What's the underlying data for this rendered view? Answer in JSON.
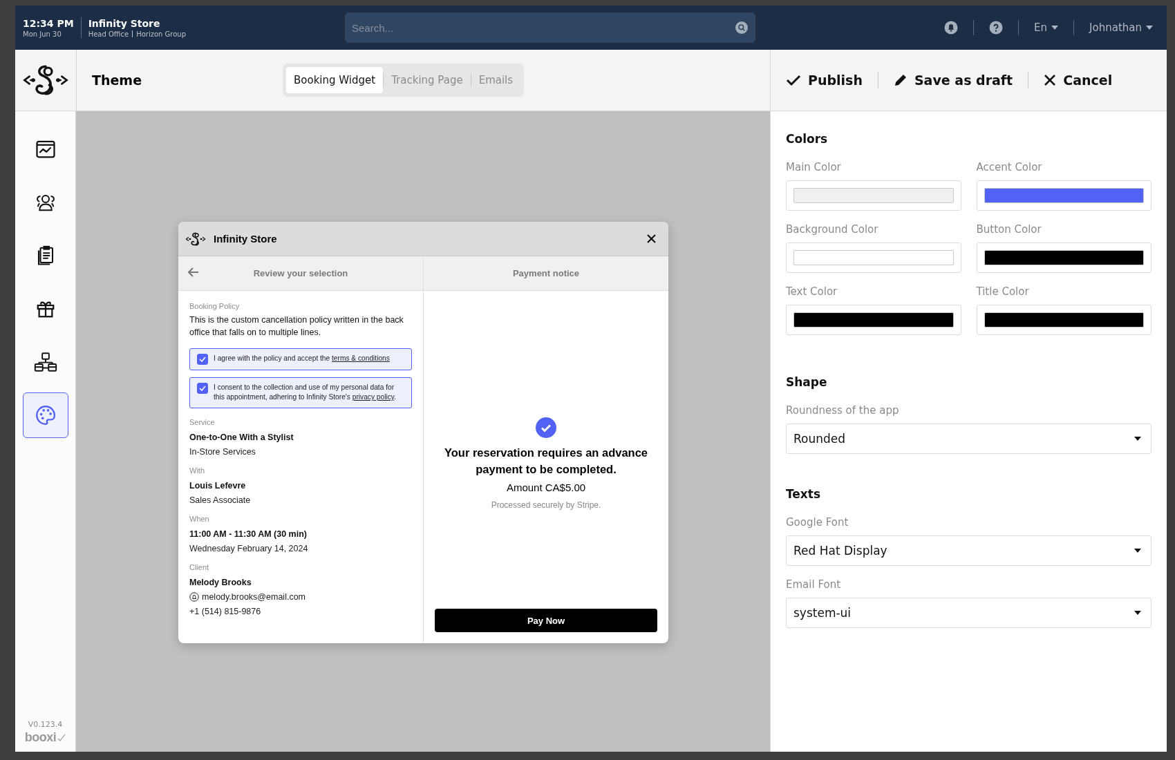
{
  "top_bar": {
    "time": "12:34 PM",
    "date": "Mon Jun 30",
    "store": "Infinity Store",
    "location": "Head Office",
    "group": "Horizon Group",
    "search": {
      "placeholder": "Search..."
    },
    "language": "En",
    "user": "Johnathan"
  },
  "header": {
    "title": "Theme",
    "tabs": [
      {
        "label": "Booking Widget",
        "selected": true
      },
      {
        "label": "Tracking Page",
        "selected": false
      },
      {
        "label": "Emails",
        "selected": false
      }
    ],
    "actions": [
      {
        "kind": "publish",
        "label": "Publish"
      },
      {
        "kind": "draft",
        "label": "Save as draft"
      },
      {
        "kind": "cancel",
        "label": "Cancel"
      }
    ]
  },
  "sidebar": {
    "items": [
      {
        "kind": "dashboard",
        "selected": false
      },
      {
        "kind": "people",
        "selected": false
      },
      {
        "kind": "clipboard",
        "selected": false
      },
      {
        "kind": "gift",
        "selected": false
      },
      {
        "kind": "stores",
        "selected": false
      },
      {
        "kind": "palette",
        "selected": true
      }
    ],
    "version": "V0.123.4",
    "brand": "booxi"
  },
  "widget": {
    "title": "Infinity Store",
    "review": {
      "title": "Review your selection",
      "policy_label": "Booking Policy",
      "policy_text": "This is the custom cancellation policy written in the back office that falls on to multiple lines.",
      "consents": [
        {
          "text": "I agree with the policy and accept the ",
          "link": "terms & conditions",
          "checked": true
        },
        {
          "text": "I consent to the collection and use of my personal data for this appointment, adhering to Infinity Store's ",
          "link": "privacy policy",
          "after": ".",
          "checked": true
        }
      ],
      "details": [
        {
          "label": "Service",
          "title": "One-to-One With a Stylist",
          "lines": [
            {
              "kind": "plain",
              "text": "In-Store Services"
            }
          ]
        },
        {
          "label": "With",
          "title": "Louis Lefevre",
          "lines": [
            {
              "kind": "plain",
              "text": "Sales Associate"
            }
          ]
        },
        {
          "label": "When",
          "title": "11:00 AM - 11:30 AM (30 min)",
          "lines": [
            {
              "kind": "plain",
              "text": "Wednesday February 14, 2024"
            }
          ]
        },
        {
          "label": "Client",
          "title": "Melody Brooks",
          "lines": [
            {
              "kind": "email",
              "text": "melody.brooks@email.com"
            },
            {
              "kind": "plain",
              "text": "+1 (514) 815-9876"
            }
          ]
        }
      ]
    },
    "payment": {
      "title": "Payment notice",
      "message": "Your reservation requires an advance payment to be completed.",
      "amount": "Amount CA$5.00",
      "note": "Processed securely by Stripe.",
      "button": "Pay Now"
    }
  },
  "settings": {
    "colors": {
      "title": "Colors",
      "swatches": [
        {
          "label": "Main Color",
          "color": "#f0f0f0"
        },
        {
          "label": "Accent Color",
          "color": "#5262f5"
        },
        {
          "label": "Background Color",
          "color": "#ffffff"
        },
        {
          "label": "Button Color",
          "color": "#000000"
        },
        {
          "label": "Text Color",
          "color": "#000000"
        },
        {
          "label": "Title Color",
          "color": "#000000"
        }
      ]
    },
    "shape": {
      "title": "Shape",
      "selects": [
        {
          "label": "Roundness of the app",
          "value": "Rounded"
        }
      ]
    },
    "texts": {
      "title": "Texts",
      "selects": [
        {
          "label": "Google Font",
          "value": "Red Hat Display"
        },
        {
          "label": "Email Font",
          "value": "system-ui"
        }
      ]
    }
  }
}
